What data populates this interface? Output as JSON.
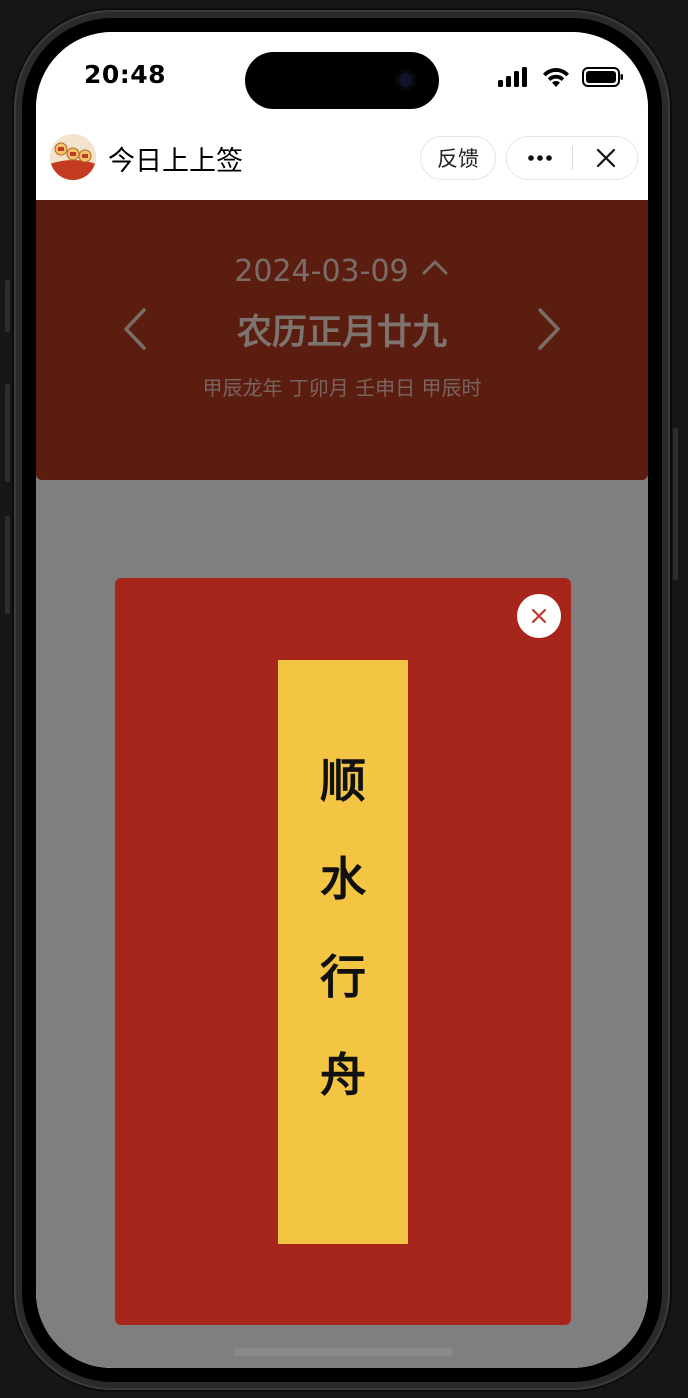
{
  "status_bar": {
    "time": "20:48",
    "icons": [
      "signal-icon",
      "wifi-icon",
      "battery-icon"
    ]
  },
  "nav": {
    "title": "今日上上签",
    "feedback_label": "反馈",
    "more_icon": "more-dots-icon",
    "close_icon": "close-icon"
  },
  "header": {
    "date": "2024-03-09",
    "lunar_date": "农历正月廿九",
    "ganzhi": "甲辰龙年 丁卯月 壬申日 甲辰时",
    "prev_icon": "chevron-left-icon",
    "next_icon": "chevron-right-icon",
    "toggle_icon": "chevron-up-icon"
  },
  "modal": {
    "sign_chars": [
      "顺",
      "水",
      "行",
      "舟"
    ],
    "close_icon": "close-icon"
  },
  "colors": {
    "header_bg": "#b93a22",
    "modal_bg": "#a7261c",
    "sign_bg": "#f4c443",
    "overlay": "rgba(0,0,0,0.5)"
  }
}
